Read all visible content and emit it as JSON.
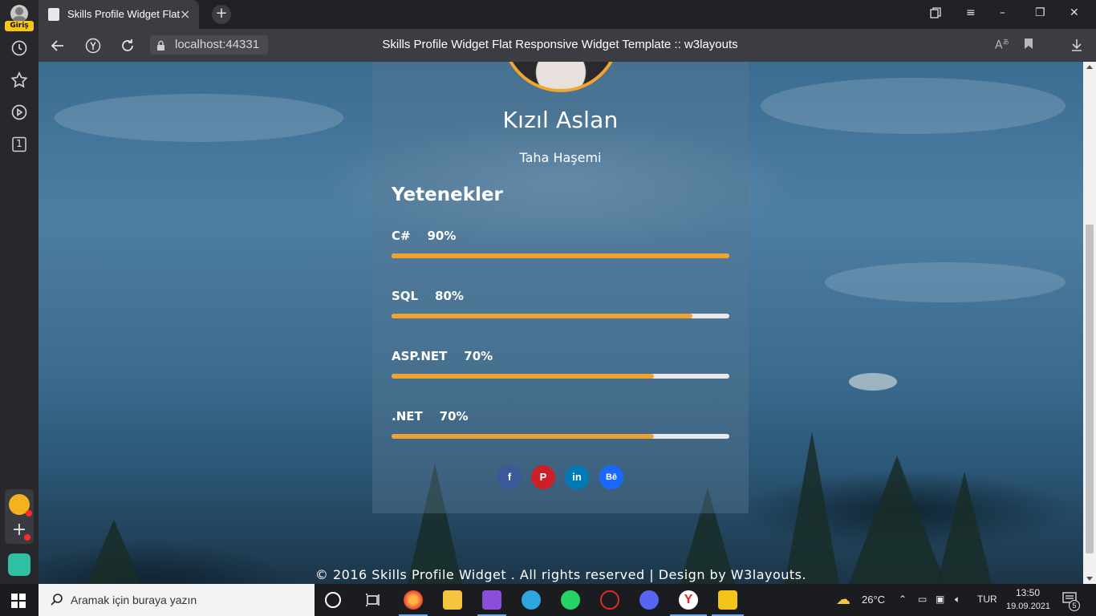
{
  "sidebar": {
    "login_badge": "Giriş",
    "tab_count": "1"
  },
  "tab": {
    "title": "Skills Profile Widget Flat",
    "close_label": "×",
    "newtab_label": "+"
  },
  "window_controls": {
    "minimize": "–",
    "restore": "❐",
    "close": "✕"
  },
  "address_bar": {
    "url": "localhost:44331",
    "page_title": "Skills Profile Widget Flat Responsive Widget Template :: w3layouts"
  },
  "profile": {
    "name": "Kızıl Aslan",
    "subtitle": "Taha Haşemi"
  },
  "skills_heading": "Yetenekler",
  "skills": [
    {
      "label": "C#    90%",
      "fill": 1.0
    },
    {
      "label": "SQL    80%",
      "fill": 0.89
    },
    {
      "label": "ASP.NET    70%",
      "fill": 0.777
    },
    {
      "label": ".NET    70%",
      "fill": 0.777
    }
  ],
  "social": {
    "facebook": "f",
    "pinterest": "P",
    "linkedin": "in",
    "behance": "Bē"
  },
  "footer": "© 2016 Skills Profile Widget . All rights reserved | Design by W3layouts.",
  "colors": {
    "accent": "#f0a22e",
    "facebook": "#3b5998",
    "pinterest": "#cb2027",
    "linkedin": "#007bb6",
    "behance": "#1769ff"
  },
  "taskbar": {
    "search_placeholder": "Aramak için buraya yazın",
    "temperature": "26°C",
    "language": "TUR",
    "time": "13:50",
    "date": "19.09.2021",
    "notification_count": "5"
  }
}
